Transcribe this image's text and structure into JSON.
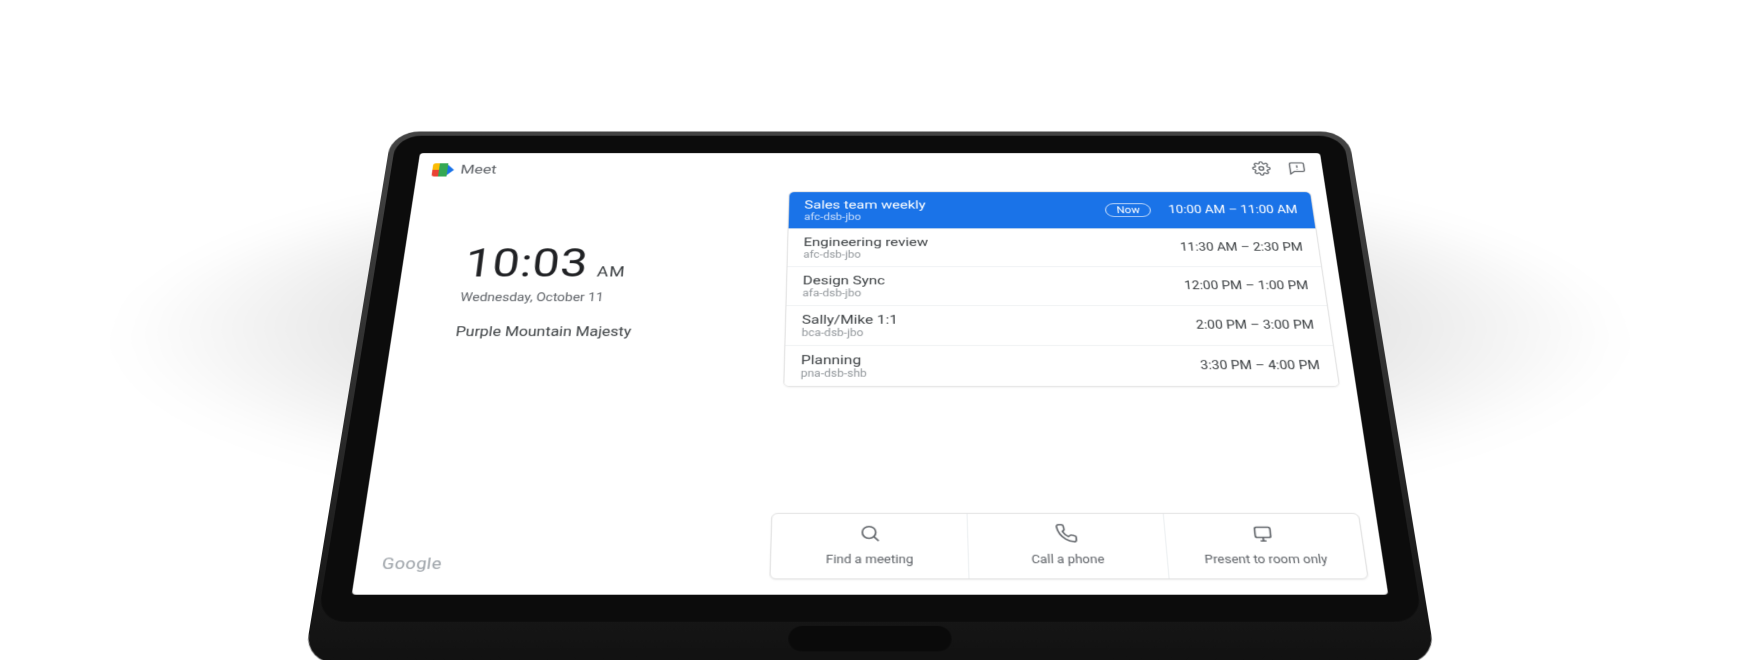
{
  "header": {
    "app_name": "Meet"
  },
  "clock": {
    "time": "10:03",
    "ampm": "AM",
    "date": "Wednesday, October 11",
    "room_name": "Purple Mountain Majesty"
  },
  "meetings": [
    {
      "title": "Sales team weekly",
      "code": "afc-dsb-jbo",
      "time": "10:00 AM – 11:00 AM",
      "now": true,
      "now_label": "Now"
    },
    {
      "title": "Engineering review",
      "code": "afc-dsb-jbo",
      "time": "11:30 AM – 2:30 PM",
      "now": false
    },
    {
      "title": "Design Sync",
      "code": "afa-dsb-jbo",
      "time": "12:00 PM – 1:00 PM",
      "now": false
    },
    {
      "title": "Sally/Mike 1:1",
      "code": "bca-dsb-jbo",
      "time": "2:00 PM – 3:00 PM",
      "now": false
    },
    {
      "title": "Planning",
      "code": "pna-dsb-shb",
      "time": "3:30 PM – 4:00 PM",
      "now": false
    }
  ],
  "actions": {
    "find": "Find a meeting",
    "call": "Call a phone",
    "present": "Present to room only"
  },
  "footer": {
    "brand": "Google"
  }
}
